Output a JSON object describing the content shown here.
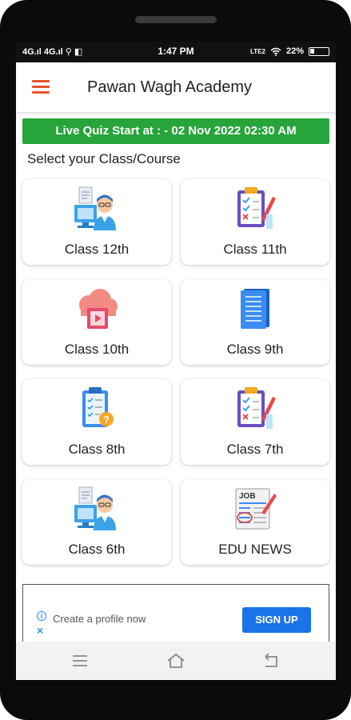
{
  "status_bar": {
    "network_left": "4G.ıl 4G.ıl ⚲ ◧",
    "time": "1:47 PM",
    "network_right": "LTE2",
    "battery_text": "22%",
    "battery_level": 0.22
  },
  "app_bar": {
    "title": "Pawan Wagh Academy",
    "menu_icon": "hamburger-menu-icon",
    "accent_color": "#e8542b"
  },
  "quiz_banner": {
    "text": "Live Quiz Start at : - 02 Nov 2022 02:30 AM",
    "color": "#27a53b"
  },
  "section_title": "Select your Class/Course",
  "cards": [
    {
      "label": "Class 12th",
      "icon": "student-computer-icon"
    },
    {
      "label": "Class 11th",
      "icon": "checklist-clipboard-icon"
    },
    {
      "label": "Class 10th",
      "icon": "cloud-video-book-icon"
    },
    {
      "label": "Class 9th",
      "icon": "notebook-icon"
    },
    {
      "label": "Class 8th",
      "icon": "question-clipboard-icon"
    },
    {
      "label": "Class 7th",
      "icon": "checklist-clipboard-icon"
    },
    {
      "label": "Class 6th",
      "icon": "student-computer-icon"
    },
    {
      "label": "EDU NEWS",
      "icon": "job-news-icon"
    }
  ],
  "ad": {
    "text": "Create a profile now",
    "button_label": "SIGN UP",
    "button_color": "#1a73e8"
  },
  "nav_bar": {
    "icons": [
      "menu-icon",
      "home-icon",
      "back-icon"
    ]
  }
}
